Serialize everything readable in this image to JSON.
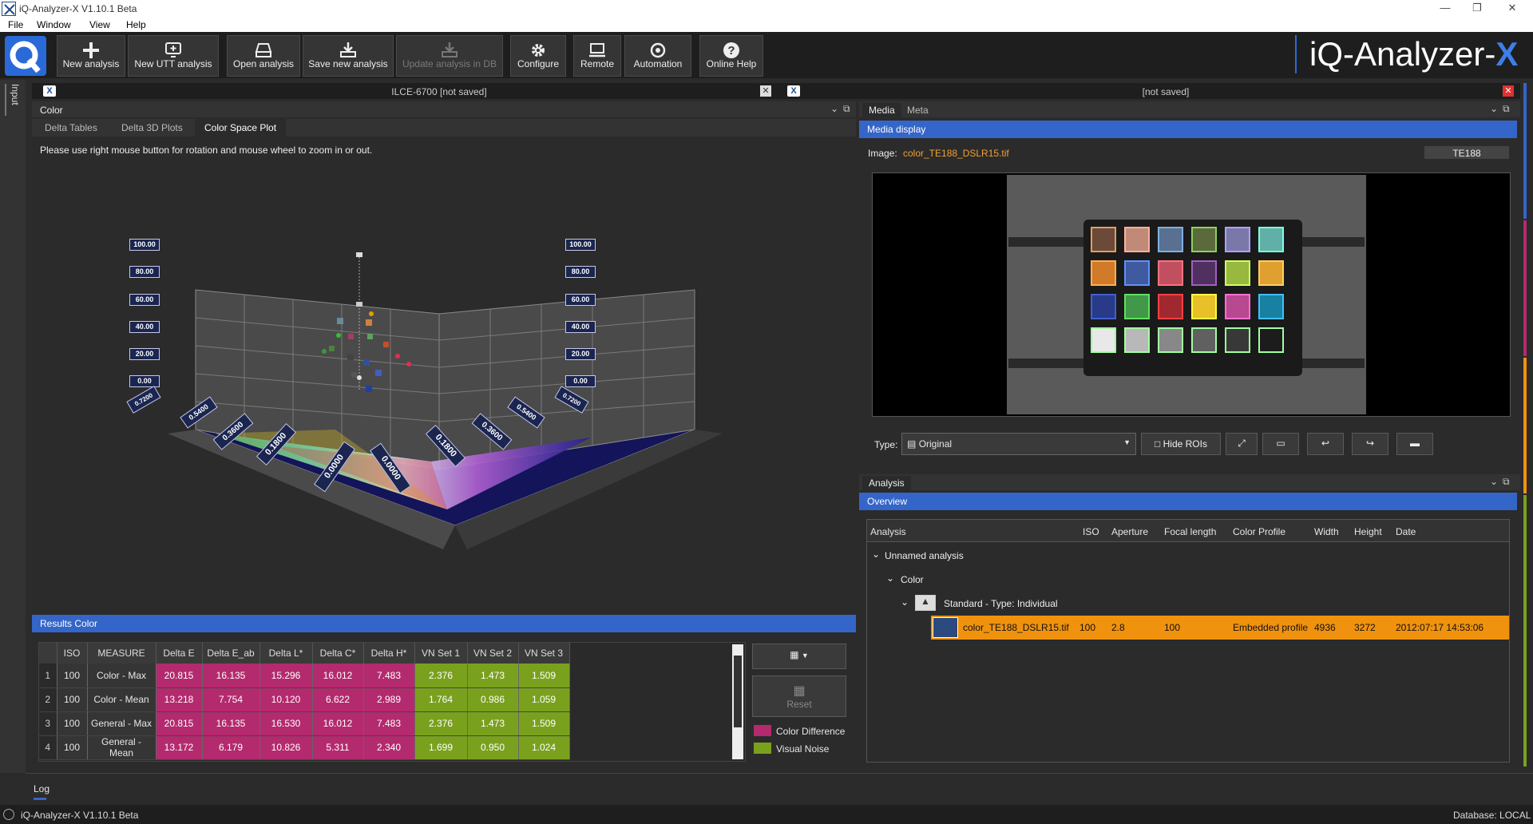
{
  "window": {
    "title": "iQ-Analyzer-X V1.10.1 Beta"
  },
  "menu": [
    "File",
    "Window",
    "View",
    "Help"
  ],
  "toolbar": {
    "buttons": [
      {
        "label": "New analysis",
        "icon": "plus-icon"
      },
      {
        "label": "New UTT analysis",
        "icon": "monitor-add-icon"
      },
      {
        "label": "Open analysis",
        "icon": "drive-open-icon"
      },
      {
        "label": "Save new analysis",
        "icon": "save-icon"
      },
      {
        "label": "Update analysis in DB",
        "icon": "db-update-icon",
        "disabled": true
      },
      {
        "label": "Configure",
        "icon": "gear-icon"
      },
      {
        "label": "Remote",
        "icon": "laptop-icon"
      },
      {
        "label": "Automation",
        "icon": "automation-icon"
      },
      {
        "label": "Online Help",
        "icon": "help-icon"
      }
    ]
  },
  "brand": {
    "text": "iQ-Analyzer-",
    "x": "X"
  },
  "sidebar": {
    "tab": "Input"
  },
  "left_panel": {
    "doc_title": "ILCE-6700  [not saved]",
    "section": "Color",
    "tabs": [
      "Delta Tables",
      "Delta 3D Plots",
      "Color Space Plot"
    ],
    "active_tab": "Color Space Plot",
    "hint": "Please use right mouse button for rotation and mouse wheel to zoom in or out.",
    "plot": {
      "y_ticks": [
        "100.00",
        "80.00",
        "60.00",
        "40.00",
        "20.00",
        "0.00"
      ],
      "x_ticks_left": [
        "0.7200",
        "0.5400",
        "0.3600",
        "0.1800",
        "0.0000"
      ],
      "x_ticks_right": [
        "0.7200",
        "0.5400",
        "0.3600",
        "0.1800",
        "0.0000"
      ]
    },
    "results": {
      "title": "Results Color",
      "columns": [
        "ISO",
        "MEASURE",
        "Delta E",
        "Delta E_ab",
        "Delta L*",
        "Delta C*",
        "Delta H*",
        "VN Set 1",
        "VN Set 2",
        "VN Set 3"
      ],
      "rows": [
        {
          "n": "1",
          "iso": "100",
          "measure": "Color - Max",
          "de": "20.815",
          "deab": "16.135",
          "dl": "15.296",
          "dc": "16.012",
          "dh": "7.483",
          "vn1": "2.376",
          "vn2": "1.473",
          "vn3": "1.509"
        },
        {
          "n": "2",
          "iso": "100",
          "measure": "Color - Mean",
          "de": "13.218",
          "deab": "7.754",
          "dl": "10.120",
          "dc": "6.622",
          "dh": "2.989",
          "vn1": "1.764",
          "vn2": "0.986",
          "vn3": "1.059"
        },
        {
          "n": "3",
          "iso": "100",
          "measure": "General - Max",
          "de": "20.815",
          "deab": "16.135",
          "dl": "16.530",
          "dc": "16.012",
          "dh": "7.483",
          "vn1": "2.376",
          "vn2": "1.473",
          "vn3": "1.509"
        },
        {
          "n": "4",
          "iso": "100",
          "measure": "General - Mean",
          "de": "13.172",
          "deab": "6.179",
          "dl": "10.826",
          "dc": "5.311",
          "dh": "2.340",
          "vn1": "1.699",
          "vn2": "0.950",
          "vn3": "1.024"
        }
      ],
      "reset_label": "Reset",
      "legend": [
        {
          "label": "Color Difference",
          "color": "#b42a6e"
        },
        {
          "label": "Visual Noise",
          "color": "#7aa11e"
        }
      ]
    }
  },
  "right_panel": {
    "doc_title": "[not saved]",
    "tabs": [
      "Media",
      "Meta"
    ],
    "media_bar": "Media display",
    "image_label": "Image:",
    "image_file": "color_TE188_DSLR15.tif",
    "chart_tag": "TE188",
    "type_label": "Type:",
    "type_value": "Original",
    "hide_rois": "Hide ROIs",
    "analysis_tab": "Analysis",
    "overview_bar": "Overview",
    "overview_columns": [
      "Analysis",
      "ISO",
      "Aperture",
      "Focal length",
      "Color Profile",
      "Width",
      "Height",
      "Date"
    ],
    "tree": {
      "root": "Unnamed analysis",
      "child": "Color",
      "grandchild": "Standard - Type: Individual",
      "item": {
        "name": "color_TE188_DSLR15.tif",
        "iso": "100",
        "aperture": "2.8",
        "focal": "100",
        "profile": "Embedded profile",
        "width": "4936",
        "height": "3272",
        "date": "2012:07:17 14:53:06"
      }
    }
  },
  "log": {
    "title": "Log"
  },
  "statusbar": {
    "left": "iQ-Analyzer-X V1.10.1 Beta",
    "right": "Database: LOCAL"
  },
  "colors": {
    "accent_blue": "#3465c8",
    "selected_row": "#f0920e",
    "color_difference": "#b42a6e",
    "visual_noise": "#7aa11e"
  }
}
